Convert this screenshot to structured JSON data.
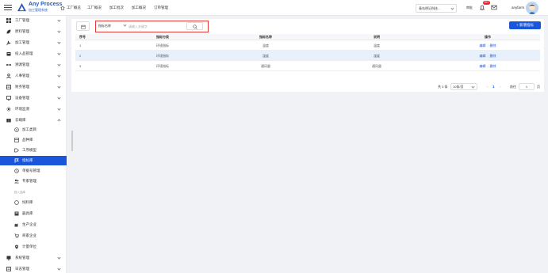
{
  "header": {
    "logo_title": "Any Process",
    "logo_subtitle": "加工管理系统",
    "nav": [
      "工厂概览",
      "工厂概况",
      "加工批次",
      "加工概况",
      "订单管理"
    ],
    "org_select": "青岛明记科技...",
    "label": "审批",
    "badge": "99+",
    "user": "anyfarm"
  },
  "sidebar": {
    "items": [
      {
        "label": "工厂管理",
        "icon": "grid-icon",
        "chevron": "down"
      },
      {
        "label": "原料管理",
        "icon": "leaf-icon",
        "chevron": "down"
      },
      {
        "label": "加工管理",
        "icon": "tool-icon",
        "chevron": "down"
      },
      {
        "label": "投入品管理",
        "icon": "box-icon",
        "chevron": "down"
      },
      {
        "label": "溯源管理",
        "icon": "trace-icon",
        "chevron": "down"
      },
      {
        "label": "人事管理",
        "icon": "user-icon",
        "chevron": "down"
      },
      {
        "label": "财务管理",
        "icon": "finance-icon",
        "chevron": "down"
      },
      {
        "label": "设备管理",
        "icon": "device-icon",
        "chevron": "down"
      },
      {
        "label": "环境监测",
        "icon": "env-icon",
        "chevron": "down"
      },
      {
        "label": "云端库",
        "icon": "library-icon",
        "chevron": "up"
      }
    ],
    "sub_items": [
      {
        "label": "加工类目",
        "icon": "category-icon"
      },
      {
        "label": "品种库",
        "icon": "variety-icon"
      },
      {
        "label": "工序模型",
        "icon": "process-icon"
      },
      {
        "label": "指标库",
        "icon": "flag-icon",
        "active": true
      },
      {
        "label": "单据号管理",
        "icon": "doc-icon"
      },
      {
        "label": "专家管理",
        "icon": "expert-icon"
      }
    ],
    "group_label": "投入品库",
    "group_items": [
      {
        "label": "饲料库",
        "icon": "feed-icon"
      },
      {
        "label": "器具库",
        "icon": "tools-icon"
      },
      {
        "label": "生产企业",
        "icon": "factory-icon"
      },
      {
        "label": "商家企业",
        "icon": "shop-icon"
      },
      {
        "label": "计量单位",
        "icon": "unit-icon"
      }
    ],
    "bottom_items": [
      {
        "label": "系统管理",
        "icon": "system-icon",
        "chevron": "down"
      },
      {
        "label": "日志管理",
        "icon": "log-icon",
        "chevron": "down"
      }
    ]
  },
  "toolbar": {
    "search_field": "指标名称",
    "search_placeholder": "请输入关键字",
    "add_button": "+ 新增指标"
  },
  "table": {
    "columns": [
      "序号",
      "指标分类",
      "指标名称",
      "说明",
      "操作"
    ],
    "rows": [
      {
        "no": "1",
        "category": "环境指标",
        "name": "温度",
        "desc": "温度",
        "highlight": false
      },
      {
        "no": "2",
        "category": "环境指标",
        "name": "湿度",
        "desc": "湿度",
        "highlight": true
      },
      {
        "no": "3",
        "category": "环境指标",
        "name": "通风量",
        "desc": "通风量",
        "highlight": false
      }
    ],
    "edit_label": "编辑",
    "delete_label": "删除"
  },
  "pager": {
    "total": "共 3 条",
    "page_size": "10条/页",
    "current": "1",
    "goto_label": "前往",
    "goto_value": "1",
    "page_suffix": "页"
  },
  "colors": {
    "primary": "#1a56db",
    "highlight_row": "#e8f0fb",
    "search_border": "#e53935"
  }
}
